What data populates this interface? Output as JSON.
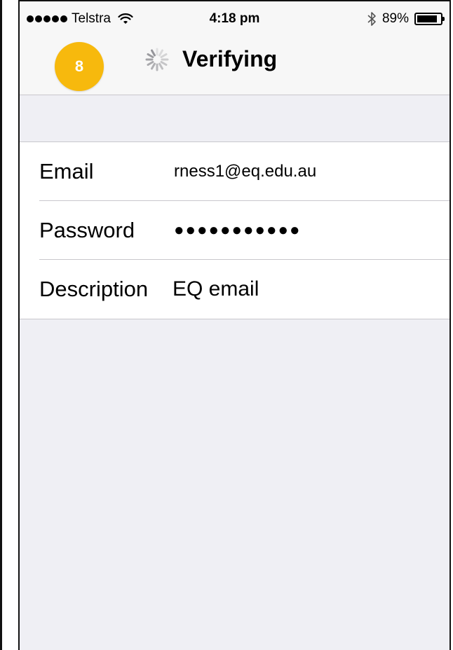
{
  "status_bar": {
    "carrier": "Telstra",
    "time": "4:18 pm",
    "battery_percent": "89%",
    "battery_level": 0.89,
    "icons": [
      "signal-dots-icon",
      "wifi-icon",
      "bluetooth-icon",
      "battery-icon"
    ]
  },
  "nav": {
    "step_number": "8",
    "step_badge_color": "#f7b90d",
    "title": "Verifying",
    "spinner_icon": "activity-spinner-icon"
  },
  "form": {
    "rows": [
      {
        "label": "Email",
        "value": "rness1@eq.edu.au"
      },
      {
        "label": "Password",
        "value": "●●●●●●●●●●●"
      },
      {
        "label": "Description",
        "value": "EQ email"
      }
    ]
  },
  "colors": {
    "background": "#efeff4",
    "surface": "#ffffff",
    "separator": "#c8c7cc"
  }
}
